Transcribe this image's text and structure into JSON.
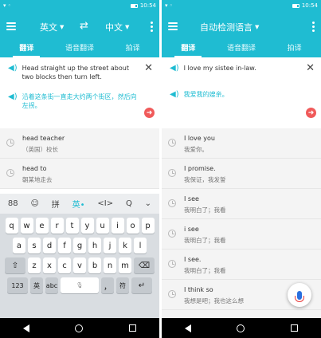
{
  "status_bar": {
    "time": "10:54"
  },
  "left": {
    "toolbar": {
      "source_lang": "英文",
      "target_lang": "中文"
    },
    "tabs": [
      {
        "label": "翻译",
        "active": true
      },
      {
        "label": "语音翻译",
        "active": false
      },
      {
        "label": "拍译",
        "active": false
      }
    ],
    "input": {
      "source_text": "Head straight up the street about two blocks then turn left.",
      "target_text": "沿着这条街一直走大约两个街区，然后向左拐。"
    },
    "history": [
      {
        "src": "head teacher",
        "tgt": "（英国）校长"
      },
      {
        "src": "head to",
        "tgt": "朝某地走去"
      }
    ],
    "keyboard": {
      "toolbar": [
        "88",
        "☺",
        "拼",
        "英•",
        "<I>",
        "Q",
        "⌄"
      ],
      "row1": [
        "q",
        "w",
        "e",
        "r",
        "t",
        "y",
        "u",
        "i",
        "o",
        "p"
      ],
      "row2": [
        "a",
        "s",
        "d",
        "f",
        "g",
        "h",
        "j",
        "k",
        "l"
      ],
      "row3": [
        "z",
        "x",
        "c",
        "v",
        "b",
        "n",
        "m"
      ],
      "row4": {
        "num": "123",
        "lang": "英",
        "abc": "abc",
        "comma": "，",
        "period": "符"
      }
    }
  },
  "right": {
    "toolbar": {
      "title": "自动检测语言"
    },
    "tabs": [
      {
        "label": "翻译",
        "active": true
      },
      {
        "label": "语音翻译",
        "active": false
      },
      {
        "label": "拍译",
        "active": false
      }
    ],
    "input": {
      "source_text": "I love my sistee in-law.",
      "target_text": "我爱我的嫂亲。"
    },
    "history": [
      {
        "src": "I love you",
        "tgt": "我爱你。"
      },
      {
        "src": "I promise.",
        "tgt": "我保证，我发誓"
      },
      {
        "src": "I see",
        "tgt": "我明白了；我看"
      },
      {
        "src": "i see",
        "tgt": "我明白了；我看"
      },
      {
        "src": "I see.",
        "tgt": "我明白了；我看"
      },
      {
        "src": "I think so",
        "tgt": "我想是吧；我也这么想"
      }
    ]
  },
  "colors": {
    "brand": "#1fbcd2",
    "send": "#f05a5a",
    "mic": "#2a6fde"
  }
}
